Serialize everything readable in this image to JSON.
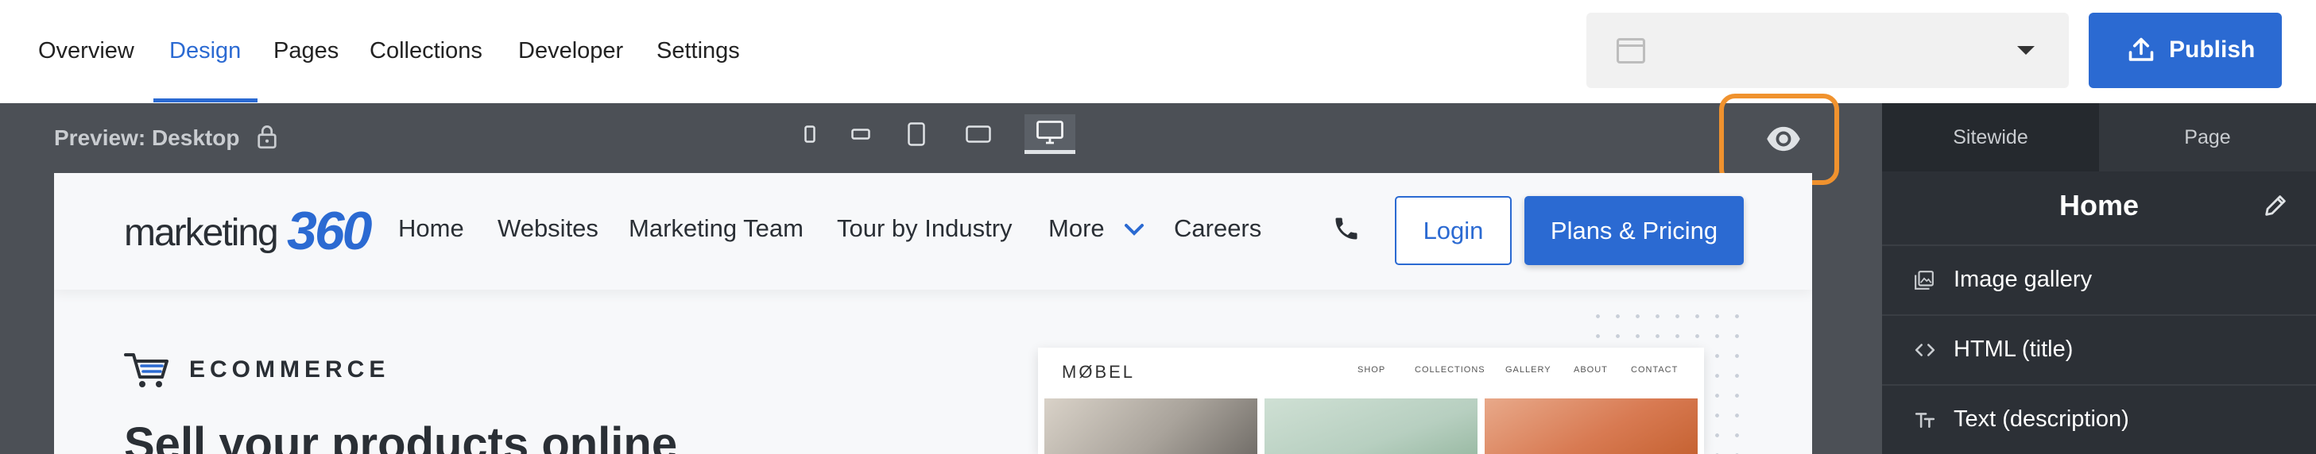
{
  "nav": {
    "tabs": [
      {
        "label": "Overview"
      },
      {
        "label": "Design"
      },
      {
        "label": "Pages"
      },
      {
        "label": "Collections"
      },
      {
        "label": "Developer"
      },
      {
        "label": "Settings"
      }
    ],
    "active_tab": "Design"
  },
  "publish": {
    "label": "Publish"
  },
  "preview": {
    "label": "Preview: Desktop",
    "devices": [
      "phone-portrait",
      "phone-landscape",
      "tablet-portrait",
      "tablet-landscape",
      "desktop"
    ],
    "active_device": "desktop"
  },
  "site": {
    "logo": {
      "word1": "marketing",
      "word2": "360"
    },
    "nav": [
      "Home",
      "Websites",
      "Marketing Team",
      "Tour by Industry",
      "More",
      "Careers"
    ],
    "login_label": "Login",
    "plans_label": "Plans & Pricing",
    "eyebrow": "ECOMMERCE",
    "hero_title": "Sell your products online",
    "mockup": {
      "brand": "MØBEL",
      "nav": [
        "SHOP",
        "COLLECTIONS",
        "GALLERY",
        "ABOUT",
        "CONTACT"
      ]
    }
  },
  "panel": {
    "tabs": [
      "Sitewide",
      "Page"
    ],
    "active_tab": "Page",
    "title": "Home",
    "items": [
      {
        "icon": "image-icon",
        "label": "Image gallery"
      },
      {
        "icon": "code-icon",
        "label": "HTML (title)"
      },
      {
        "icon": "text-icon",
        "label": "Text (description)"
      }
    ]
  },
  "colors": {
    "accent": "#2b6ad2",
    "highlight": "#f0922e",
    "workspace_bg": "#4c5056",
    "panel_bg": "#2c3036"
  }
}
